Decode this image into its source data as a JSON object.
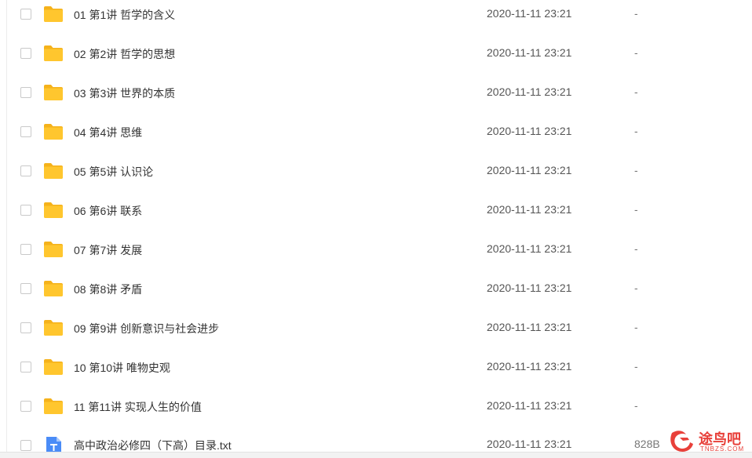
{
  "rows": [
    {
      "name": "01 第1讲 哲学的含义",
      "date": "2020-11-11 23:21",
      "size": "-",
      "type": "folder"
    },
    {
      "name": "02 第2讲 哲学的思想",
      "date": "2020-11-11 23:21",
      "size": "-",
      "type": "folder"
    },
    {
      "name": "03 第3讲 世界的本质",
      "date": "2020-11-11 23:21",
      "size": "-",
      "type": "folder"
    },
    {
      "name": "04 第4讲 思维",
      "date": "2020-11-11 23:21",
      "size": "-",
      "type": "folder"
    },
    {
      "name": "05 第5讲 认识论",
      "date": "2020-11-11 23:21",
      "size": "-",
      "type": "folder"
    },
    {
      "name": "06 第6讲 联系",
      "date": "2020-11-11 23:21",
      "size": "-",
      "type": "folder"
    },
    {
      "name": "07 第7讲 发展",
      "date": "2020-11-11 23:21",
      "size": "-",
      "type": "folder"
    },
    {
      "name": "08 第8讲 矛盾",
      "date": "2020-11-11 23:21",
      "size": "-",
      "type": "folder"
    },
    {
      "name": "09 第9讲 创新意识与社会进步",
      "date": "2020-11-11 23:21",
      "size": "-",
      "type": "folder"
    },
    {
      "name": "10 第10讲 唯物史观",
      "date": "2020-11-11 23:21",
      "size": "-",
      "type": "folder"
    },
    {
      "name": "11 第11讲 实现人生的价值",
      "date": "2020-11-11 23:21",
      "size": "-",
      "type": "folder"
    },
    {
      "name": "高中政治必修四（下高）目录.txt",
      "date": "2020-11-11 23:21",
      "size": "828B",
      "type": "txt"
    }
  ],
  "icons": {
    "folder": "folder-icon",
    "txt": "text-file-icon"
  },
  "colors": {
    "folder": "#FFC62E",
    "folder_tab": "#F5B21B",
    "txt": "#4A8CF7",
    "watermark": "#E8403A"
  },
  "watermark": {
    "text": "途鸟吧",
    "sub": "TNBZS.COM"
  }
}
